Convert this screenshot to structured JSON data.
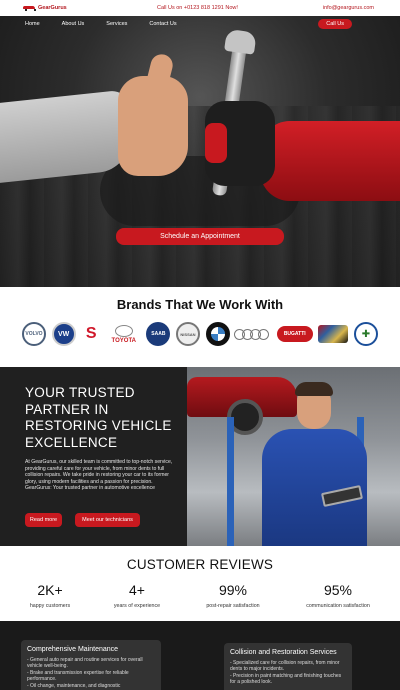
{
  "topbar": {
    "logo_text": "GearGurus",
    "phone": "Call Us on +0123 818 1291 Now!",
    "email": "info@geargurus.com"
  },
  "nav": {
    "items": [
      "Home",
      "About Us",
      "Services",
      "Contact Us"
    ],
    "cta": "Call Us"
  },
  "hero": {
    "cta": "Schedule an Appointment"
  },
  "brands": {
    "title": "Brands That We Work With",
    "logos": [
      "volvo-logo",
      "volkswagen-logo",
      "suzuki-logo",
      "toyota-logo",
      "saab-logo",
      "nissan-logo",
      "bmw-logo",
      "audi-logo",
      "bugatti-logo",
      "cadillac-logo",
      "alfa-romeo-logo"
    ],
    "suzuki_text": "SUZUKI",
    "toyota_text": "TOYOTA",
    "bugatti_text": "BUGATTI"
  },
  "partner": {
    "title": "YOUR TRUSTED PARTNER IN RESTORING VEHICLE EXCELLENCE",
    "text": "At GearGurus, our skilled team is committed to top-notch service, providing careful care for your vehicle, from minor dents to full collision repairs. We take pride in restoring your car to its former glory, using modern facilities and a passion for precision. GearGurus: Your trusted partner in automotive excellence",
    "btn_read": "Read more",
    "btn_tech": "Meet our technicians"
  },
  "reviews": {
    "title": "CUSTOMER REVIEWS",
    "stats": [
      {
        "num": "2K+",
        "label": "happy customers"
      },
      {
        "num": "4+",
        "label": "years of experience"
      },
      {
        "num": "99%",
        "label": "post-repair satisfaction"
      },
      {
        "num": "95%",
        "label": "communication satisfaction"
      }
    ]
  },
  "services": {
    "cards": [
      {
        "title": "Comprehensive Maintenance",
        "items": [
          "- General auto repair and routine services for overall vehicle well-being.",
          "- Brake and transmission expertise for reliable performance.",
          "- Oil change, maintenance, and diagnostic"
        ]
      },
      {
        "title": "Collision and Restoration Services",
        "items": [
          "- Specialized care for collision repairs, from minor dents to major incidents.",
          "- Precision in paint matching and finishing touches for a polished look."
        ]
      }
    ]
  },
  "colors": {
    "accent": "#c8191f",
    "dark": "#202020"
  }
}
